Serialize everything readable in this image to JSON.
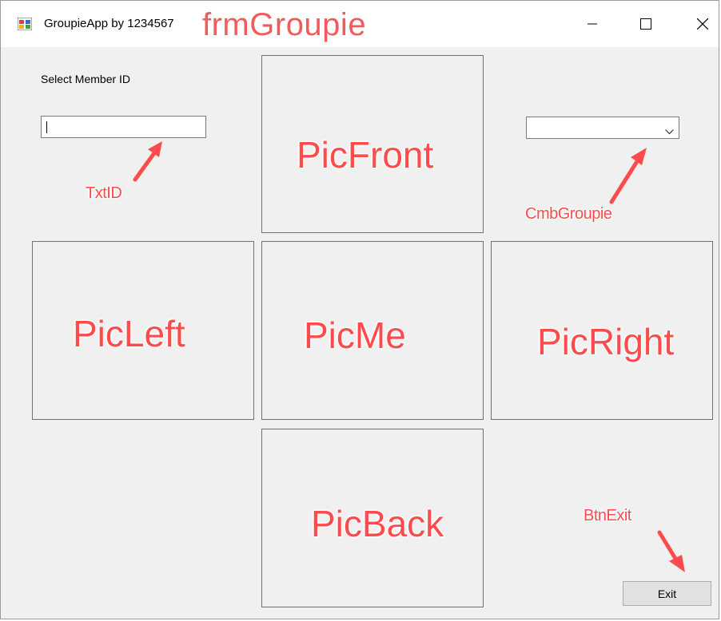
{
  "window": {
    "title": "GroupieApp by 1234567",
    "annotation": "frmGroupie",
    "controls": {
      "minimize": "minimize-icon",
      "maximize": "maximize-icon",
      "close": "close-icon"
    }
  },
  "form": {
    "select_label": "Select Member ID",
    "txt_id_value": "",
    "combo_selected": "",
    "exit_label": "Exit"
  },
  "annotations": {
    "txtid": "TxtID",
    "cmbgroupie": "CmbGroupie",
    "picfront": "PicFront",
    "picleft": "PicLeft",
    "picme": "PicMe",
    "picright": "PicRight",
    "picback": "PicBack",
    "btnexit": "BtnExit"
  },
  "colors": {
    "annotation": "#ff4b4b",
    "form_bg": "#f0f0f0",
    "button_bg": "#e1e1e1"
  }
}
